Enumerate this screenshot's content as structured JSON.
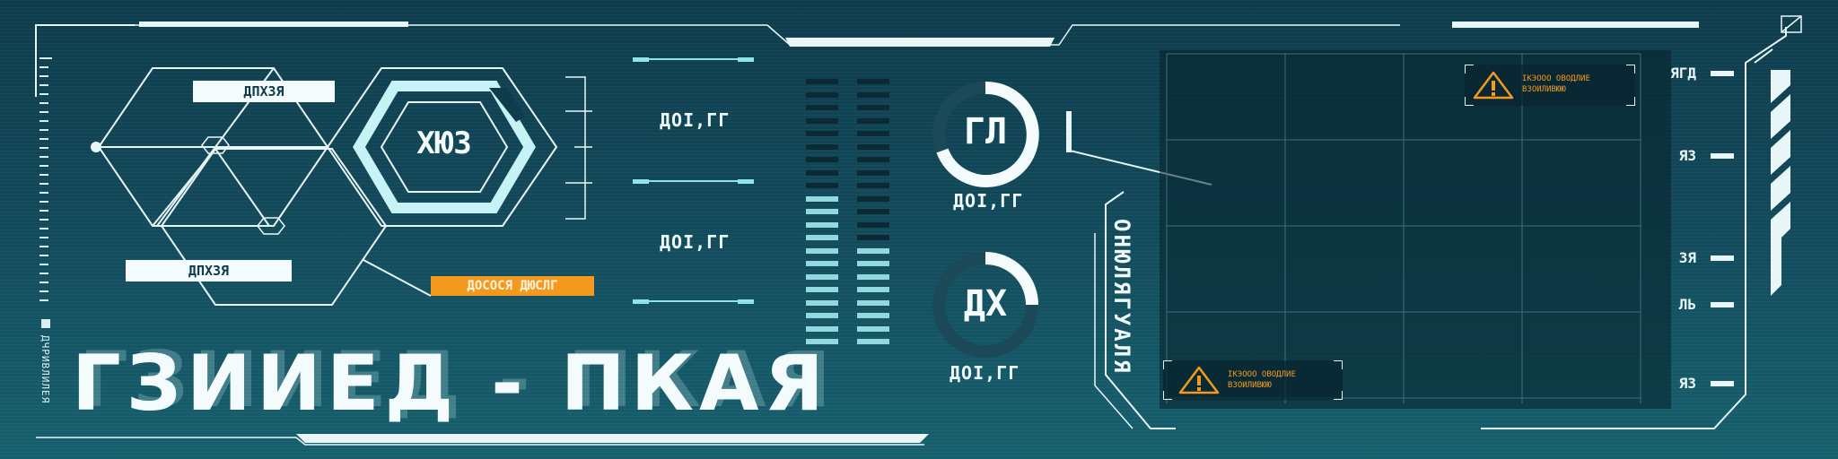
{
  "title": "ГЗИИЕД - ПКАЯ",
  "hex_panel": {
    "tag_top": "ДПХЗЯ",
    "tag_bottom": "ДПХЗЯ",
    "hex_label": "ХЮЗ",
    "orange_tag": "ДОСОСЯ ДЮСЛГ"
  },
  "readouts": {
    "r1": "ДОІ,ГГ",
    "r2": "ДОІ,ГГ",
    "ring1_value": "ГЛ",
    "ring1_caption": "ДОІ,ГГ",
    "ring2_value": "ДХ",
    "ring2_caption": "ДОІ,ГГ"
  },
  "progress": {
    "ring1": 0.85,
    "ring2": 0.3
  },
  "vertical_text": {
    "left_small": "ДЧРИВЛИЛЕЯ",
    "right_panel": "ОНЮЛЯГУАЛЯ"
  },
  "warnings": [
    {
      "line1": "ІКЭООО ОВОДЛИЕ",
      "line2": "ВЗОИЛИВЮЮ"
    },
    {
      "line1": "ІКЭООО ОВОДЛИЕ",
      "line2": "ВЗОИЛИВЮЮ"
    }
  ],
  "scale_labels": [
    "ЯГД",
    "ЯЗ",
    "ЗЯ",
    "ЛЬ",
    "ЯЗ"
  ],
  "colors": {
    "background": "#12495a",
    "accent": "#f39a1e",
    "cyan": "#8fe3ea",
    "line": "#e9f6f8"
  },
  "icons": {
    "warning": "warning-triangle-icon",
    "corner": "corner-box-icon"
  }
}
